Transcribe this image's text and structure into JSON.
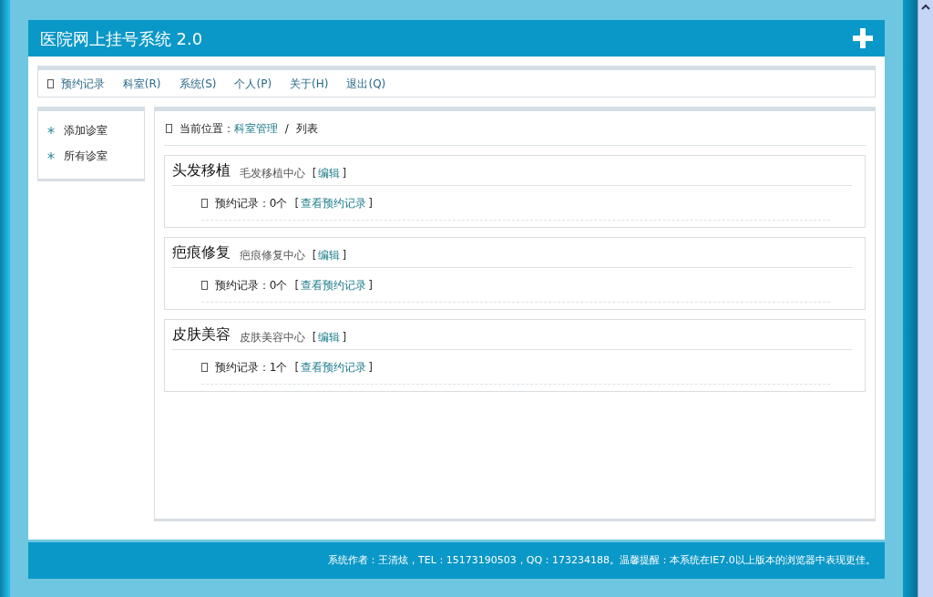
{
  "header": {
    "title": "医院网上挂号系统 2.0"
  },
  "menu": [
    {
      "label": "预约记录",
      "icon": true
    },
    {
      "label": "科室(R)",
      "icon": false
    },
    {
      "label": "系统(S)",
      "icon": false
    },
    {
      "label": "个人(P)",
      "icon": false
    },
    {
      "label": "关于(H)",
      "icon": false
    },
    {
      "label": "退出(Q)",
      "icon": false
    }
  ],
  "sidebar": {
    "items": [
      {
        "label": "添加诊室"
      },
      {
        "label": "所有诊室"
      }
    ]
  },
  "breadcrumb": {
    "prefix": "当前位置：",
    "link": "科室管理",
    "separator": "/",
    "current": "列表"
  },
  "departments": [
    {
      "name": "头发移植",
      "center": "毛发移植中心",
      "edit_open": "[",
      "edit": "编辑",
      "edit_close": "]",
      "records_label": "预约记录：0个",
      "view_open": "[",
      "view": "查看预约记录",
      "view_close": "]"
    },
    {
      "name": "疤痕修复",
      "center": "疤痕修复中心",
      "edit_open": "[",
      "edit": "编辑",
      "edit_close": "]",
      "records_label": "预约记录：0个",
      "view_open": "[",
      "view": "查看预约记录",
      "view_close": "]"
    },
    {
      "name": "皮肤美容",
      "center": "皮肤美容中心",
      "edit_open": "[",
      "edit": "编辑",
      "edit_close": "]",
      "records_label": "预约记录：1个",
      "view_open": "[",
      "view": "查看预约记录",
      "view_close": "]"
    }
  ],
  "footer": {
    "text": "系统作者：王清炫，TEL：15173190503，QQ：173234188。温馨提醒：本系统在IE7.0以上版本的浏览器中表现更佳。"
  }
}
